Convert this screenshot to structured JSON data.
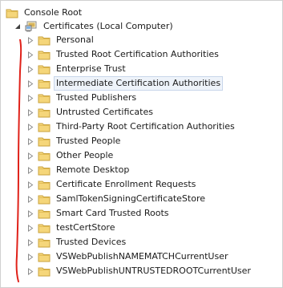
{
  "tree": {
    "root_label": "Console Root",
    "certificates_label": "Certificates (Local Computer)",
    "stores": [
      {
        "label": "Personal"
      },
      {
        "label": "Trusted Root Certification Authorities"
      },
      {
        "label": "Enterprise Trust"
      },
      {
        "label": "Intermediate Certification Authorities"
      },
      {
        "label": "Trusted Publishers"
      },
      {
        "label": "Untrusted Certificates"
      },
      {
        "label": "Third-Party Root Certification Authorities"
      },
      {
        "label": "Trusted People"
      },
      {
        "label": "Other People"
      },
      {
        "label": "Remote Desktop"
      },
      {
        "label": "Certificate Enrollment Requests"
      },
      {
        "label": "SamlTokenSigningCertificateStore"
      },
      {
        "label": "Smart Card Trusted Roots"
      },
      {
        "label": "testCertStore"
      },
      {
        "label": "Trusted Devices"
      },
      {
        "label": "VSWebPublishNAMEMATCHCurrentUser"
      },
      {
        "label": "VSWebPublishUNTRUSTEDROOTCurrentUser"
      }
    ]
  },
  "colors": {
    "folder_fill": "#f5d67a",
    "folder_stroke": "#c9a23c",
    "selection_fill": "#eef3fa",
    "annotation_red": "#e0221a"
  },
  "icons": {
    "root": "folder-icon",
    "certificates": "certificate-computer-icon",
    "store": "folder-icon",
    "expanded": "expanded-arrow-icon",
    "collapsed": "collapsed-arrow-icon"
  }
}
